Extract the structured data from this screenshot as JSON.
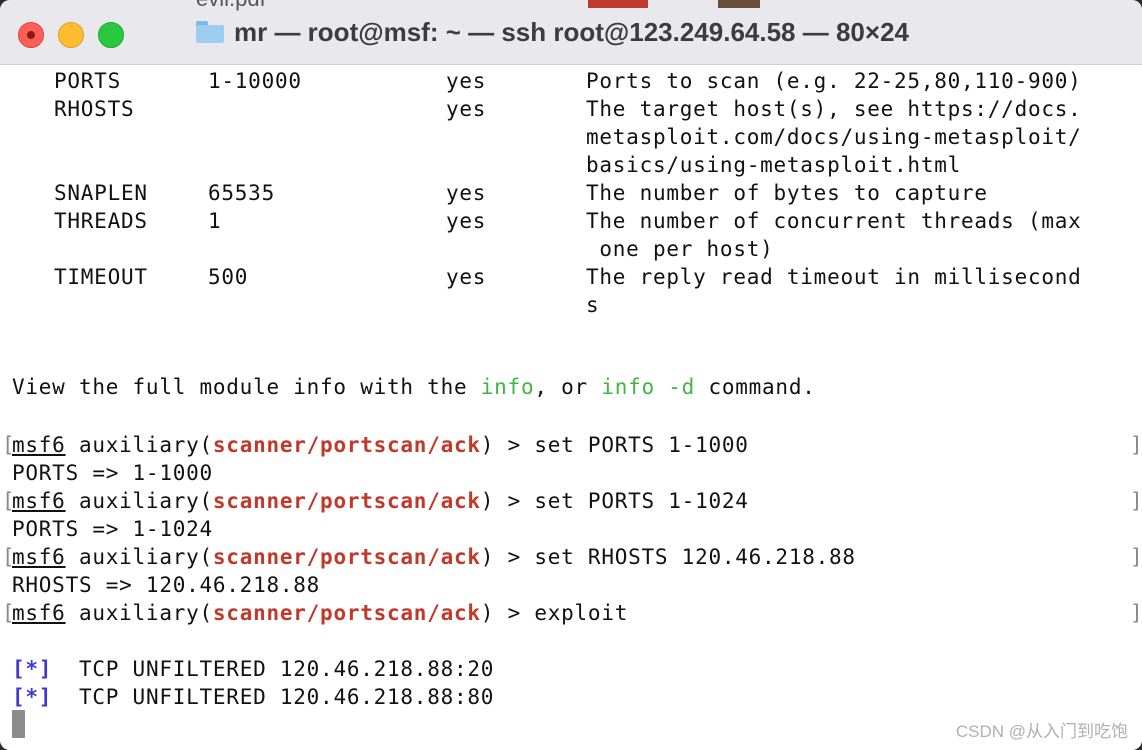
{
  "window": {
    "title": "mr — root@msf: ~ — ssh root@123.249.64.58 — 80×24",
    "background_peek_text": "evil.pdf"
  },
  "options_table": [
    {
      "name": "PORTS",
      "value": "1-10000",
      "required": "yes",
      "desc": [
        "Ports to scan (e.g. 22-25,80,110-900)"
      ]
    },
    {
      "name": "RHOSTS",
      "value": "",
      "required": "yes",
      "desc": [
        "The target host(s), see https://docs.",
        "metasploit.com/docs/using-metasploit/",
        "basics/using-metasploit.html"
      ]
    },
    {
      "name": "SNAPLEN",
      "value": "65535",
      "required": "yes",
      "desc": [
        "The number of bytes to capture"
      ]
    },
    {
      "name": "THREADS",
      "value": "1",
      "required": "yes",
      "desc": [
        "The number of concurrent threads (max",
        " one per host)"
      ]
    },
    {
      "name": "TIMEOUT",
      "value": "500",
      "required": "yes",
      "desc": [
        "The reply read timeout in millisecond",
        "s"
      ]
    }
  ],
  "info_line": {
    "prefix": "View the full module info with the ",
    "info1": "info",
    "mid": ", or ",
    "info2": "info -d",
    "suffix": " command."
  },
  "prompt": {
    "msf": "msf6",
    "module_prefix": " auxiliary(",
    "module": "scanner/portscan/ack",
    "module_suffix": ") > "
  },
  "session": [
    {
      "command": "set PORTS 1-1000",
      "output": "PORTS => 1-1000"
    },
    {
      "command": "set PORTS 1-1024",
      "output": "PORTS => 1-1024"
    },
    {
      "command": "set RHOSTS 120.46.218.88",
      "output": "RHOSTS => 120.46.218.88"
    },
    {
      "command": "exploit",
      "output": ""
    }
  ],
  "results": [
    {
      "marker": "[*]",
      "text": "  TCP UNFILTERED 120.46.218.88:20"
    },
    {
      "marker": "[*]",
      "text": "  TCP UNFILTERED 120.46.218.88:80"
    }
  ],
  "watermark": "CSDN @从入门到吃饱",
  "colors": {
    "info_green": "#3fb83f",
    "module_red": "#c0392b",
    "status_blue": "#3b3bd0"
  }
}
